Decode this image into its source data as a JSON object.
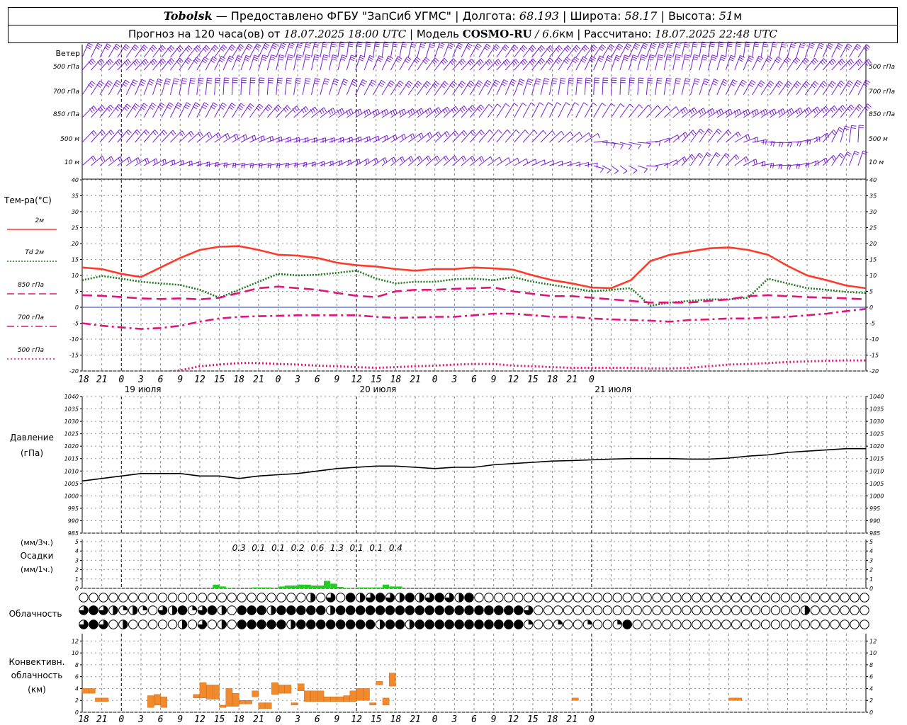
{
  "header": {
    "station": "Tobolsk",
    "provided_by": "Предоставлено ФГБУ \"ЗапСиб УГМС\"",
    "lon_label": "Долгота:",
    "lon_value": "68.193",
    "lat_label": "Широта:",
    "lat_value": "58.17",
    "alt_label": "Высота:",
    "alt_value": "51",
    "alt_unit": "м",
    "forecast_label": "Прогноз на 120 часа(ов) от",
    "forecast_from": "18.07.2025 18:00 UTC",
    "model_label": "Модель",
    "model_name": "COSMO-RU",
    "model_res": "/ 6.6",
    "model_res_unit": "км",
    "calc_label": "Рассчитано:",
    "calc_time": "18.07.2025 22:48 UTC"
  },
  "wind_panel": {
    "title": "Ветер",
    "levels": [
      "500 гПа",
      "700 гПа",
      "850 гПа",
      "500 м",
      "10 м"
    ],
    "color": "#7b1fd6"
  },
  "x_axis": {
    "hour_labels": [
      "18",
      "21",
      "0",
      "3",
      "6",
      "9",
      "12",
      "15",
      "18",
      "21",
      "0",
      "3",
      "6",
      "9",
      "12",
      "15",
      "18",
      "21",
      "0",
      "3",
      "6",
      "9",
      "12",
      "15",
      "18",
      "21",
      "0"
    ],
    "day_labels": [
      "19 июля",
      "20 июля",
      "21 июля"
    ]
  },
  "temp_panel": {
    "title": "Тем-ра(°C)",
    "legend": [
      {
        "label": "2м",
        "color": "#ff3a2a",
        "dash": "solid"
      },
      {
        "label": "Td  2м",
        "color": "#1f7a1f",
        "dash": "dotted"
      },
      {
        "label": "850 гПа",
        "color": "#e0147a",
        "dash": "long"
      },
      {
        "label": "700 гПа",
        "color": "#e0147a",
        "dash": "dashdot"
      },
      {
        "label": "500 гПа",
        "color": "#e0147a",
        "dash": "dots"
      }
    ],
    "y_ticks": [
      "40",
      "35",
      "30",
      "25",
      "20",
      "15",
      "10",
      "5",
      "0",
      "-5",
      "-10",
      "-15",
      "-20"
    ]
  },
  "pressure_panel": {
    "title": "Давление",
    "unit": "(гПа)",
    "y_ticks": [
      "1040",
      "1035",
      "1030",
      "1025",
      "1020",
      "1015",
      "1010",
      "1005",
      "1000",
      "995",
      "990",
      "985"
    ]
  },
  "precip_panel": {
    "title_top": "(мм/3ч.)",
    "title_mid": "Осадки",
    "title_bot": "(мм/1ч.)",
    "y_ticks": [
      "5",
      "4",
      "3",
      "2",
      "1",
      "0"
    ],
    "amounts_3h": [
      "0.3",
      "0.1",
      "0.1",
      "0.2",
      "0.6",
      "1.3",
      "0.1",
      "0.1",
      "0.4"
    ],
    "bar_color": "#22cc22"
  },
  "cloud_panel": {
    "title": "Облачность"
  },
  "convective_panel": {
    "title_1": "Конвективн.",
    "title_2": "облачность",
    "title_3": "(км)",
    "y_ticks": [
      "12",
      "10",
      "8",
      "6",
      "4",
      "2",
      "0"
    ],
    "bar_color": "#f08a2c"
  },
  "chart_data": [
    {
      "type": "line",
      "title": "Тем-ра(°C)",
      "x_hours": [
        0,
        3,
        6,
        9,
        12,
        15,
        18,
        21,
        24,
        27,
        30,
        33,
        36,
        39,
        42,
        45,
        48,
        51,
        54,
        57,
        60,
        63,
        66,
        69,
        72,
        75,
        78,
        81,
        84,
        87,
        90,
        93,
        96,
        99,
        102,
        105,
        108,
        111,
        114,
        117,
        120
      ],
      "ylim": [
        -20,
        40
      ],
      "series": [
        {
          "name": "2м",
          "values": [
            12.5,
            12.0,
            10.5,
            9.5,
            12.5,
            15.5,
            18.0,
            19.0,
            19.2,
            18.0,
            16.5,
            16.2,
            15.5,
            14.0,
            13.2,
            12.8,
            12.0,
            11.5,
            12.0,
            12.0,
            12.5,
            12.2,
            11.8,
            10.0,
            8.5,
            7.5,
            6.2,
            6.0,
            8.5,
            14.5,
            16.5,
            17.5,
            18.5,
            18.8,
            18.0,
            16.5,
            13.0,
            10.0,
            8.5,
            6.8,
            6.0
          ]
        },
        {
          "name": "Td 2м",
          "values": [
            8.5,
            9.8,
            9.0,
            8.0,
            7.5,
            7.0,
            5.5,
            3.0,
            5.5,
            8.0,
            10.5,
            10.0,
            10.2,
            10.8,
            11.5,
            9.0,
            7.5,
            8.0,
            8.0,
            8.8,
            9.0,
            8.5,
            9.5,
            8.0,
            7.0,
            6.0,
            5.0,
            5.5,
            6.0,
            0.5,
            1.5,
            2.0,
            2.5,
            2.5,
            3.0,
            9.0,
            7.5,
            6.0,
            5.5,
            4.8,
            4.5
          ]
        },
        {
          "name": "850 гПа",
          "values": [
            3.8,
            3.6,
            3.2,
            2.8,
            2.6,
            2.8,
            2.5,
            3.0,
            4.5,
            6.0,
            6.5,
            6.0,
            5.5,
            4.5,
            3.6,
            3.2,
            5.0,
            5.5,
            5.5,
            5.8,
            6.0,
            6.2,
            5.0,
            4.2,
            3.5,
            3.5,
            3.0,
            2.5,
            2.0,
            1.5,
            1.5,
            1.5,
            2.0,
            2.5,
            3.5,
            3.8,
            3.5,
            3.2,
            3.0,
            2.8,
            2.5
          ]
        },
        {
          "name": "700 гПа",
          "values": [
            -5.0,
            -5.8,
            -6.3,
            -6.8,
            -6.5,
            -5.8,
            -4.5,
            -3.5,
            -3.0,
            -2.8,
            -2.7,
            -2.5,
            -2.5,
            -2.5,
            -2.5,
            -3.0,
            -3.3,
            -3.2,
            -3.0,
            -3.0,
            -2.5,
            -2.0,
            -2.0,
            -2.5,
            -3.0,
            -3.0,
            -3.5,
            -3.8,
            -4.0,
            -4.2,
            -4.5,
            -4.0,
            -3.8,
            -3.5,
            -3.5,
            -3.2,
            -3.0,
            -2.5,
            -2.0,
            -1.2,
            -0.5
          ]
        },
        {
          "name": "500 гПа",
          "values": [
            -21.0,
            -20.8,
            -20.5,
            -20.5,
            -20.5,
            -19.8,
            -18.5,
            -18.0,
            -17.5,
            -17.5,
            -17.8,
            -18.0,
            -18.3,
            -18.5,
            -18.8,
            -19.0,
            -18.8,
            -18.5,
            -18.3,
            -18.0,
            -17.8,
            -17.8,
            -18.3,
            -18.5,
            -18.8,
            -19.0,
            -19.0,
            -19.0,
            -19.0,
            -19.2,
            -19.2,
            -19.0,
            -18.5,
            -18.0,
            -17.8,
            -17.5,
            -17.2,
            -17.0,
            -16.8,
            -16.7,
            -16.7
          ]
        }
      ]
    },
    {
      "type": "line",
      "title": "Давление",
      "ylabel": "(гПа)",
      "x_hours": [
        0,
        3,
        6,
        9,
        12,
        15,
        18,
        21,
        24,
        27,
        30,
        33,
        36,
        39,
        42,
        45,
        48,
        51,
        54,
        57,
        60,
        63,
        66,
        69,
        72,
        75,
        78,
        81,
        84,
        87,
        90,
        93,
        96,
        99,
        102,
        105,
        108,
        111,
        114,
        117,
        120
      ],
      "ylim": [
        985,
        1040
      ],
      "series": [
        {
          "name": "Давление",
          "values": [
            1006,
            1007,
            1008,
            1009,
            1009,
            1009,
            1008,
            1008,
            1007,
            1008,
            1008.5,
            1009,
            1010,
            1011,
            1011.5,
            1012,
            1012,
            1011.5,
            1011,
            1011.5,
            1011.5,
            1012.5,
            1013,
            1013.5,
            1014,
            1014.2,
            1014.5,
            1014.8,
            1015,
            1015,
            1015,
            1014.8,
            1014.8,
            1015.2,
            1016,
            1016.5,
            1017.5,
            1018,
            1018.5,
            1019,
            1019
          ]
        }
      ]
    },
    {
      "type": "bar",
      "title": "Осадки",
      "ylabel": "(мм/1ч.)",
      "ylim": [
        0,
        5
      ],
      "x_hours": [
        20,
        21,
        22,
        23,
        24,
        25,
        26,
        27,
        28,
        29,
        30,
        31,
        32,
        33,
        34,
        35,
        36,
        37,
        38,
        39,
        40,
        41,
        42,
        43,
        44,
        45,
        46,
        47,
        48,
        49,
        50
      ],
      "values": [
        0.4,
        0.2,
        0.05,
        0,
        0,
        0,
        0.1,
        0.1,
        0.1,
        0,
        0.2,
        0.3,
        0.3,
        0.4,
        0.4,
        0.3,
        0.3,
        0.8,
        0.5,
        0.15,
        0.05,
        0,
        0.1,
        0.1,
        0.1,
        0.1,
        0.4,
        0.2,
        0.2,
        0,
        0
      ]
    },
    {
      "type": "bar",
      "title": "Конвективн. облачность",
      "ylabel": "(км)",
      "ylim": [
        0,
        13
      ],
      "bars": [
        {
          "x": 0,
          "bottom": 3.2,
          "top": 4.0
        },
        {
          "x": 1,
          "bottom": 3.2,
          "top": 4.0
        },
        {
          "x": 2,
          "bottom": 1.8,
          "top": 2.4
        },
        {
          "x": 3,
          "bottom": 1.8,
          "top": 2.4
        },
        {
          "x": 10,
          "bottom": 0.8,
          "top": 2.8
        },
        {
          "x": 11,
          "bottom": 1.2,
          "top": 3.0
        },
        {
          "x": 12,
          "bottom": 0.8,
          "top": 2.6
        },
        {
          "x": 17,
          "bottom": 2.4,
          "top": 3.0
        },
        {
          "x": 18,
          "bottom": 2.4,
          "top": 5.0
        },
        {
          "x": 19,
          "bottom": 2.2,
          "top": 4.6
        },
        {
          "x": 20,
          "bottom": 2.2,
          "top": 4.6
        },
        {
          "x": 21,
          "bottom": 0.8,
          "top": 1.2
        },
        {
          "x": 22,
          "bottom": 1.0,
          "top": 4.0
        },
        {
          "x": 23,
          "bottom": 1.0,
          "top": 3.2
        },
        {
          "x": 24,
          "bottom": 1.4,
          "top": 2.0
        },
        {
          "x": 25,
          "bottom": 1.4,
          "top": 2.0
        },
        {
          "x": 26,
          "bottom": 2.6,
          "top": 3.6
        },
        {
          "x": 27,
          "bottom": 0.6,
          "top": 1.6
        },
        {
          "x": 28,
          "bottom": 0.6,
          "top": 1.6
        },
        {
          "x": 29,
          "bottom": 3.0,
          "top": 5.0
        },
        {
          "x": 30,
          "bottom": 3.2,
          "top": 4.6
        },
        {
          "x": 31,
          "bottom": 3.2,
          "top": 4.6
        },
        {
          "x": 32,
          "bottom": 1.2,
          "top": 1.6
        },
        {
          "x": 33,
          "bottom": 3.6,
          "top": 4.8
        },
        {
          "x": 34,
          "bottom": 1.8,
          "top": 3.6
        },
        {
          "x": 35,
          "bottom": 1.8,
          "top": 3.6
        },
        {
          "x": 36,
          "bottom": 1.8,
          "top": 3.6
        },
        {
          "x": 37,
          "bottom": 1.8,
          "top": 2.6
        },
        {
          "x": 38,
          "bottom": 1.8,
          "top": 2.6
        },
        {
          "x": 39,
          "bottom": 1.8,
          "top": 2.6
        },
        {
          "x": 40,
          "bottom": 1.8,
          "top": 2.8
        },
        {
          "x": 41,
          "bottom": 1.8,
          "top": 3.6
        },
        {
          "x": 42,
          "bottom": 2.0,
          "top": 4.0
        },
        {
          "x": 43,
          "bottom": 2.0,
          "top": 4.0
        },
        {
          "x": 44,
          "bottom": 1.2,
          "top": 1.6
        },
        {
          "x": 45,
          "bottom": 4.6,
          "top": 5.2
        },
        {
          "x": 46,
          "bottom": 1.2,
          "top": 2.4
        },
        {
          "x": 47,
          "bottom": 4.4,
          "top": 6.6
        },
        {
          "x": 75,
          "bottom": 2.0,
          "top": 2.4
        },
        {
          "x": 99,
          "bottom": 2.0,
          "top": 2.4
        },
        {
          "x": 100,
          "bottom": 2.0,
          "top": 2.4
        }
      ]
    }
  ]
}
